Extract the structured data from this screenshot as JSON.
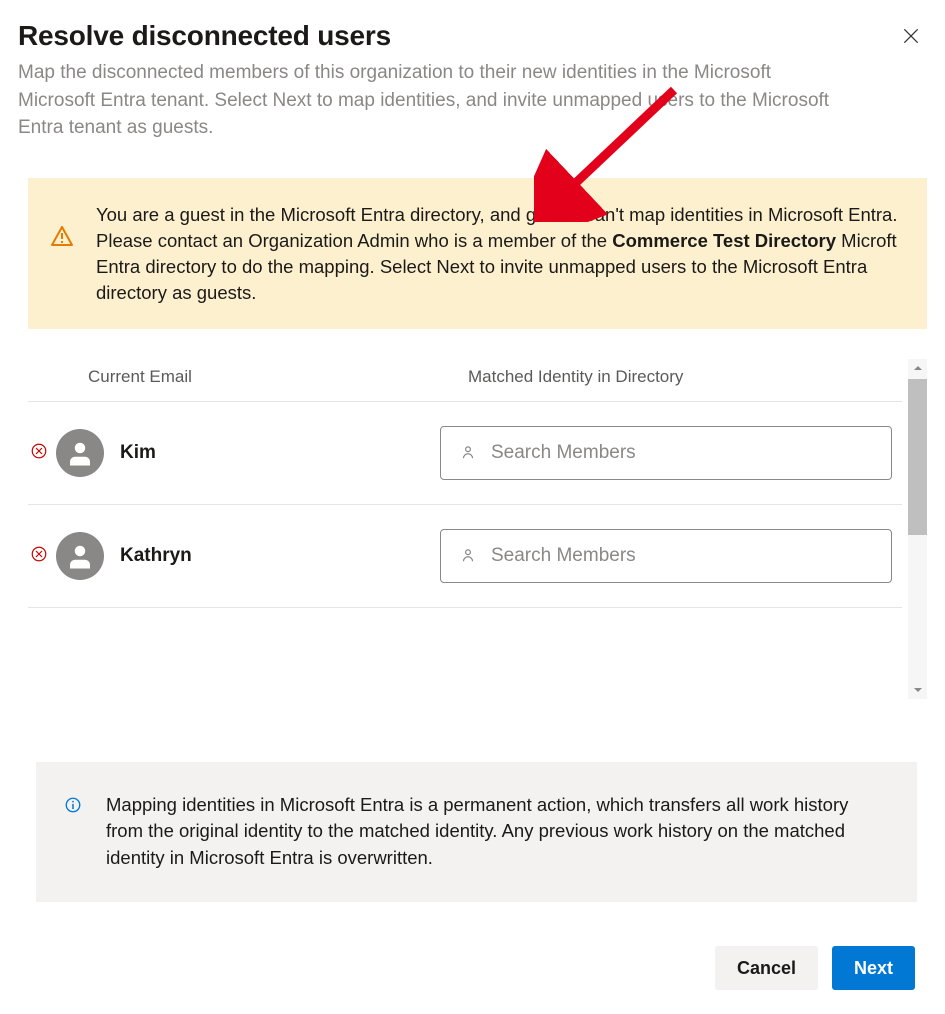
{
  "header": {
    "title": "Resolve disconnected users",
    "subtitle": "Map the disconnected members of this organization to their new identities in the Microsoft Microsoft Entra tenant. Select Next to map identities, and invite unmapped users to the Microsoft Entra tenant as guests."
  },
  "warning_banner": {
    "text_prefix": "You are a guest in the Microsoft Entra directory, and guests can't map identities in Microsoft Entra. Please contact an Organization Admin who is a member of the ",
    "bold_directory": "Commerce Test Directory",
    "text_suffix": " Microft Entra directory to do the mapping. Select Next to invite unmapped users to the Microsoft Entra directory as guests."
  },
  "columns": {
    "current_email": "Current Email",
    "matched_identity": "Matched Identity in Directory"
  },
  "users": [
    {
      "name": "Kim",
      "search_placeholder": "Search Members"
    },
    {
      "name": "Kathryn",
      "search_placeholder": "Search Members"
    }
  ],
  "info_banner": {
    "text": "Mapping identities in Microsoft Entra is a permanent action, which transfers all work history from the original identity to the matched identity. Any previous work history on the matched identity in Microsoft Entra is overwritten."
  },
  "buttons": {
    "cancel": "Cancel",
    "next": "Next"
  }
}
